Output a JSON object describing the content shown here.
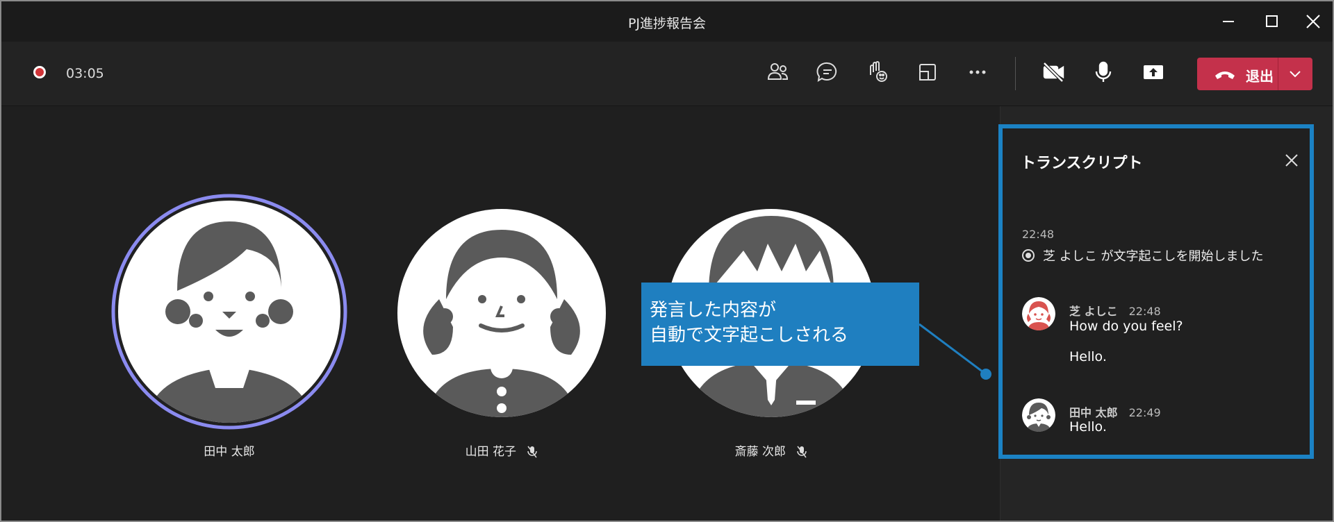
{
  "window": {
    "title": "PJ進捗報告会"
  },
  "toolbar": {
    "timer": "03:05",
    "leave_label": "退出",
    "icons": [
      "people-icon",
      "chat-icon",
      "raise-hand-icon",
      "share-tray-icon",
      "more-icon",
      "camera-off-icon",
      "mic-icon",
      "share-screen-icon"
    ]
  },
  "participants": [
    {
      "name": "田中 太郎",
      "muted": false,
      "speaking": true
    },
    {
      "name": "山田 花子",
      "muted": true,
      "speaking": false
    },
    {
      "name": "斎藤 次郎",
      "muted": true,
      "speaking": false
    }
  ],
  "callout": {
    "line1": "発言した内容が",
    "line2": "自動で文字起こしされる"
  },
  "transcript": {
    "title": "トランスクリプト",
    "start_time": "22:48",
    "start_message": "芝 よしこ が文字起こしを開始しました",
    "messages": [
      {
        "author": "芝 よしこ",
        "time": "22:48",
        "lines": [
          "How do you feel?",
          "Hello."
        ]
      },
      {
        "author": "田中 太郎",
        "time": "22:49",
        "lines": [
          "Hello."
        ]
      }
    ]
  },
  "colors": {
    "accent_blue": "#1b82c4",
    "leave_red": "#c4314b",
    "speaking_ring": "#8b8bf0",
    "avatar_gray": "#5a5a5a"
  }
}
